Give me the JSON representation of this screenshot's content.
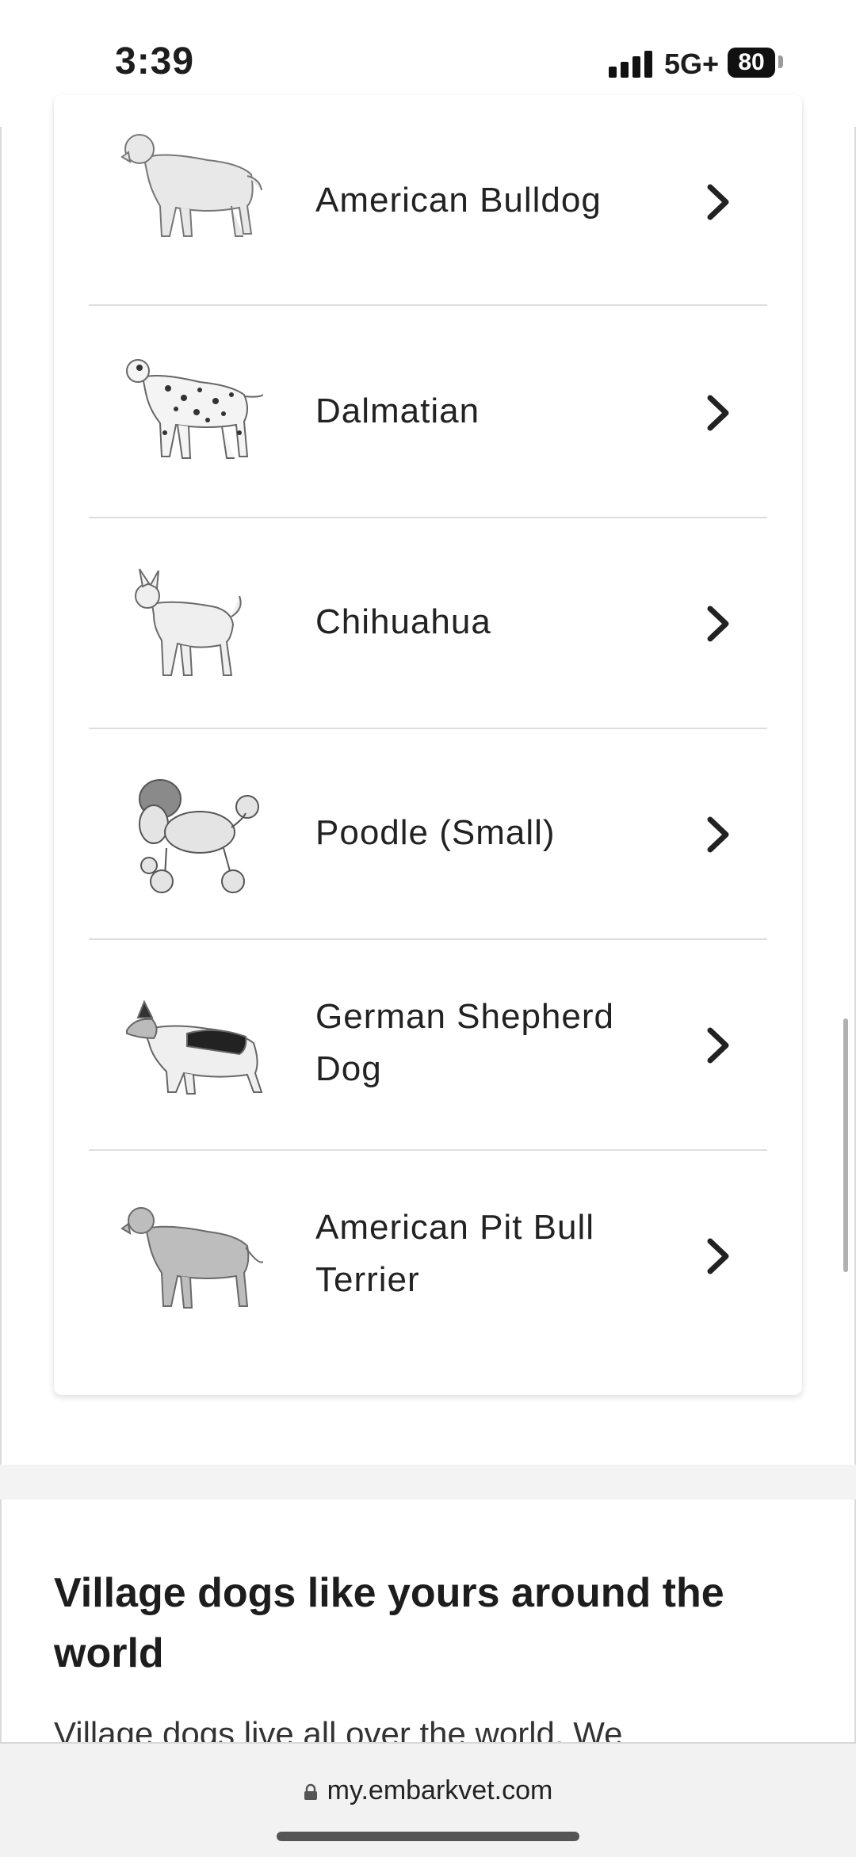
{
  "status_bar": {
    "time": "3:39",
    "network": "5G+",
    "battery": "80"
  },
  "breeds": [
    {
      "name": "American Bulldog",
      "icon": "american-bulldog-illustration"
    },
    {
      "name": "Dalmatian",
      "icon": "dalmatian-illustration"
    },
    {
      "name": "Chihuahua",
      "icon": "chihuahua-illustration"
    },
    {
      "name": "Poodle (Small)",
      "icon": "poodle-illustration"
    },
    {
      "name": "German Shepherd Dog",
      "icon": "german-shepherd-illustration"
    },
    {
      "name": "American Pit Bull Terrier",
      "icon": "pit-bull-illustration"
    }
  ],
  "section": {
    "title": "Village dogs like yours around the world",
    "body": "Village dogs live all over the world. We"
  },
  "browser": {
    "url": "my.embarkvet.com"
  },
  "colors": {
    "text": "#1d1d1d",
    "divider": "#dedede",
    "background": "#ffffff"
  }
}
